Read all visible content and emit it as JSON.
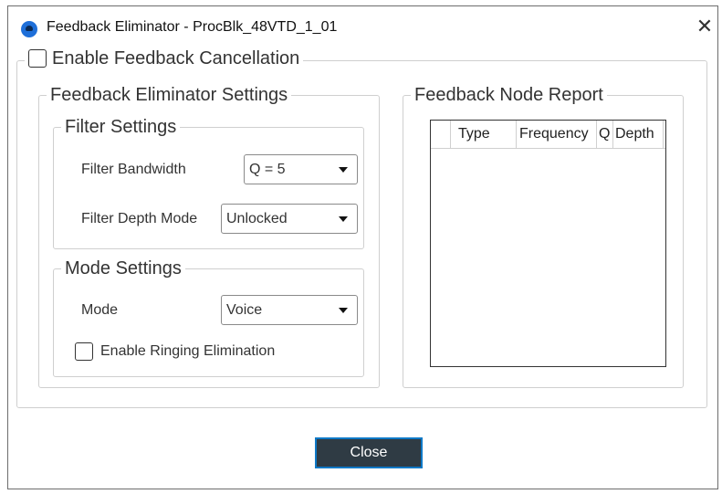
{
  "window": {
    "title": "Feedback Eliminator - ProcBlk_48VTD_1_01"
  },
  "enable_feedback_cancellation": {
    "label": "Enable Feedback Cancellation",
    "checked": false
  },
  "fe_settings": {
    "title": "Feedback Eliminator Settings",
    "filter_settings": {
      "title": "Filter Settings",
      "bandwidth_label": "Filter Bandwidth",
      "bandwidth_value": "Q = 5",
      "depth_mode_label": "Filter Depth Mode",
      "depth_mode_value": "Unlocked"
    },
    "mode_settings": {
      "title": "Mode Settings",
      "mode_label": "Mode",
      "mode_value": "Voice",
      "ringing_label": "Enable Ringing Elimination",
      "ringing_checked": false
    }
  },
  "node_report": {
    "title": "Feedback Node Report",
    "columns": [
      "Type",
      "Frequency",
      "Q",
      "Depth"
    ],
    "rows": []
  },
  "buttons": {
    "close": "Close"
  },
  "colors": {
    "button_bg": "#2f3b44",
    "button_border": "#0e79c7",
    "app_icon": "#1e6fd9"
  }
}
